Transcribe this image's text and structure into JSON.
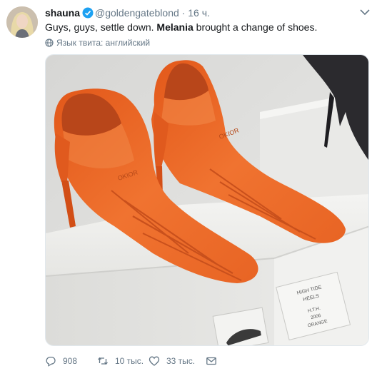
{
  "author": {
    "name": "shauna",
    "handle": "@goldengateblond",
    "separator": "·",
    "time": "16 ч."
  },
  "tweet": {
    "text_before": "Guys, guys, settle down. ",
    "text_bold": "Melania",
    "text_after": " brought a change of shoes."
  },
  "translate": {
    "label": "Язык твита: английский"
  },
  "photo": {
    "box_line1": "HIGH TIDE",
    "box_line2": "HEELS",
    "box_line3": "H.T.H.",
    "box_line4": "2006",
    "box_line5": "ORANGE",
    "fin_brand": "OKIOR"
  },
  "actions": {
    "replies": "908",
    "retweets": "10 тыс.",
    "likes": "33 тыс."
  },
  "colors": {
    "text": "#14171a",
    "muted": "#657786",
    "verified": "#1da1f2",
    "fin_orange": "#ee6a24"
  }
}
